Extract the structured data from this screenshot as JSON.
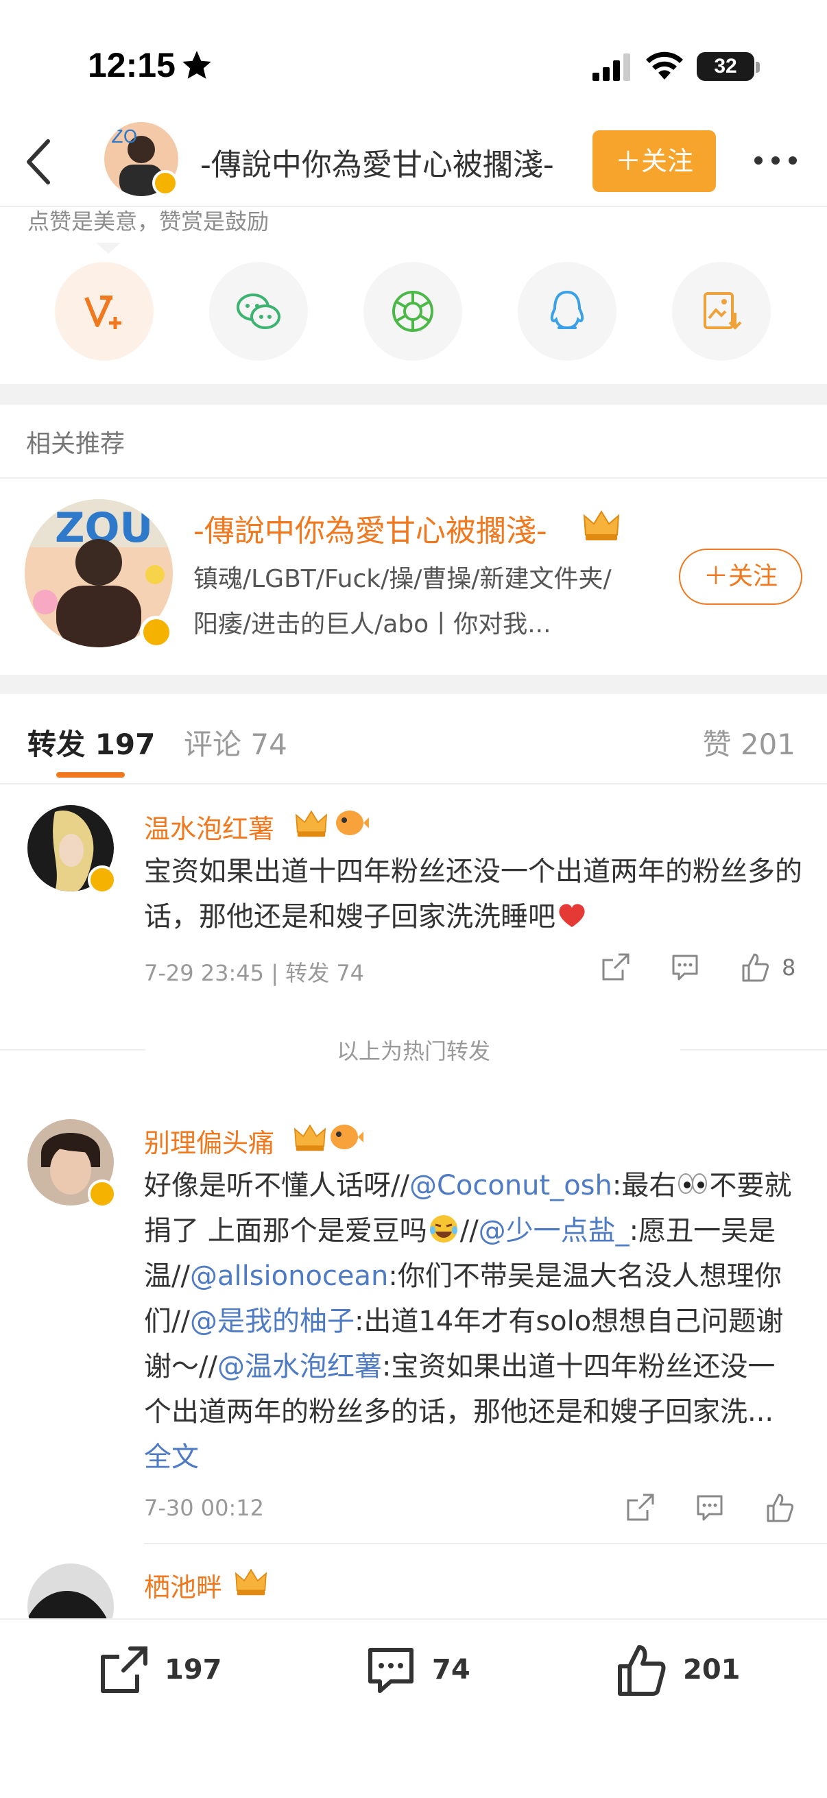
{
  "status_bar": {
    "time": "12:15",
    "battery": "32"
  },
  "nav": {
    "title": "-傳說中你為愛甘心被擱淺-",
    "follow_label": "＋关注"
  },
  "share": {
    "hint": "点赞是美意，赞赏是鼓励"
  },
  "related": {
    "heading": "相关推荐",
    "name": "-傳說中你為愛甘心被擱淺-",
    "desc": "镇魂/LGBT/Fuck/操/曹操/新建文件夹/阳痿/进击的巨人/abo丨你对我...",
    "follow_label": "＋关注"
  },
  "tabs": {
    "repost": "转发 197",
    "comment": "评论 74",
    "like": "赞 201"
  },
  "items": [
    {
      "name": "温水泡红薯",
      "text": "宝资如果出道十四年粉丝还没一个出道两年的粉丝多的话，那他还是和嫂子回家洗洗睡吧",
      "meta": "7-29 23:45 | 转发 74",
      "likes": "8"
    },
    {
      "name": "别理偏头痛",
      "t1": "好像是听不懂人话呀//",
      "m1": "@Coconut_osh",
      "t2": ":最右",
      "t3": "不要就捐了 上面那个是爱豆吗",
      "t4": "//",
      "m2": "@少一点盐_",
      "t5": ":愿丑一吴是温//",
      "m3": "@allsionocean",
      "t6": ":你们不带吴是温大名没人想理你们//",
      "m4": "@是我的柚子",
      "t7": ":出道14年才有solo想想自己问题谢谢～//",
      "m5": "@温水泡红薯",
      "t8": ":宝资如果出道十四年粉丝还没一个出道两年的粉丝多的话，那他还是和嫂子回家洗...",
      "more": "全文",
      "meta": "7-30 00:12"
    },
    {
      "name": "栖池畔"
    }
  ],
  "hot_label": "以上为热门转发",
  "bottom": {
    "repost": "197",
    "comment": "74",
    "like": "201"
  },
  "colors": {
    "accent": "#f0781e",
    "follow_bg": "#f6a42b",
    "mention": "#4e7bc4"
  }
}
